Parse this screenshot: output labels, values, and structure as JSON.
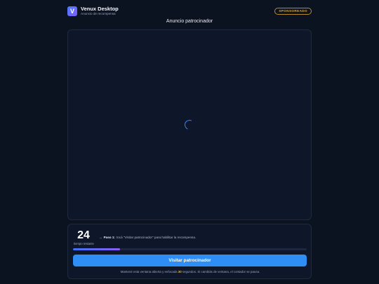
{
  "header": {
    "logo_letter": "V",
    "title": "Venux Desktop",
    "subtitle": "Anuncio de recompensa",
    "badge": "SPONSOREADO"
  },
  "ad": {
    "title": "Anuncio patrocinador",
    "loading_icon": "spinner-icon"
  },
  "reward": {
    "seconds_left": "24",
    "seconds_label": "tiempo restante",
    "step_arrow": "→",
    "step_label": "Paso 1:",
    "step_text": "tocá \"Visitar patrocinador\" para habilitar la recompensa.",
    "progress_percent": 20,
    "button_label": "Visitar patrocinador",
    "note_before": "Mantené esta ventana abierta y enfocada",
    "note_highlight": "30",
    "note_after": "segundos. Si cambiás de ventana, el contador se pausa."
  },
  "colors": {
    "background": "#0b1220",
    "accent": "#2f8df6",
    "badge": "#d9a640",
    "highlight": "#f5b942"
  }
}
